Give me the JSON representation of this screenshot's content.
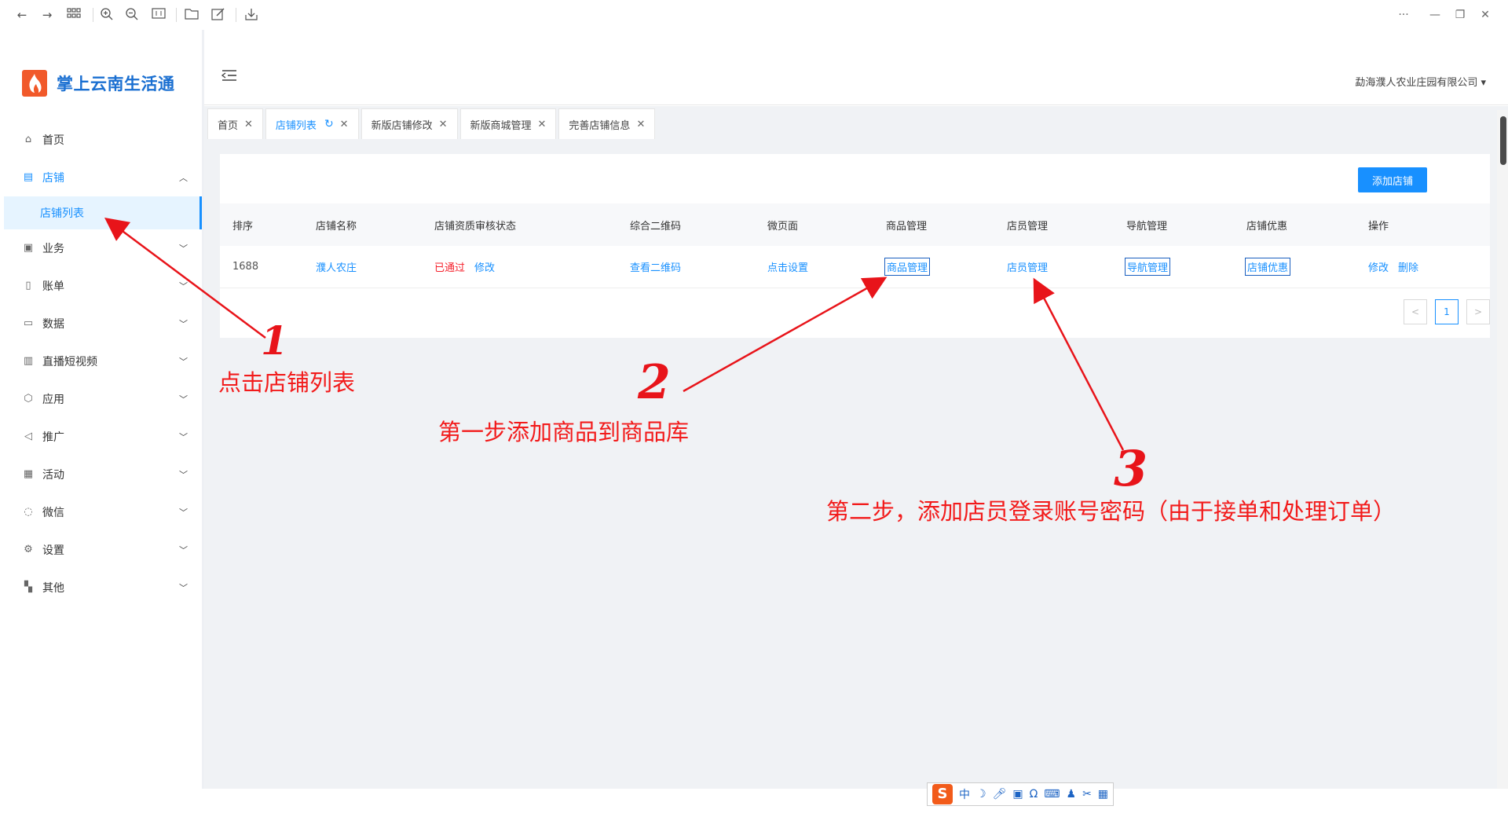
{
  "browser": {
    "more": "···",
    "minimize": "—",
    "restore": "❐",
    "close": "✕"
  },
  "app": {
    "title": "掌上云南生活通"
  },
  "header": {
    "company": "勐海濮人农业庄园有限公司"
  },
  "sidebar": {
    "items": [
      {
        "label": "首页",
        "icon": "home-icon"
      },
      {
        "label": "店铺",
        "icon": "shop-icon",
        "expanded": true
      },
      {
        "label": "业务",
        "icon": "business-icon"
      },
      {
        "label": "账单",
        "icon": "bill-icon"
      },
      {
        "label": "数据",
        "icon": "data-icon"
      },
      {
        "label": "直播短视频",
        "icon": "live-video-icon"
      },
      {
        "label": "应用",
        "icon": "app-icon"
      },
      {
        "label": "推广",
        "icon": "promote-icon"
      },
      {
        "label": "活动",
        "icon": "activity-icon"
      },
      {
        "label": "微信",
        "icon": "wechat-icon"
      },
      {
        "label": "设置",
        "icon": "settings-icon"
      },
      {
        "label": "其他",
        "icon": "other-icon"
      }
    ],
    "submenu_active": "店铺列表"
  },
  "tabs": [
    {
      "label": "首页"
    },
    {
      "label": "店铺列表",
      "active": true
    },
    {
      "label": "新版店铺修改"
    },
    {
      "label": "新版商城管理"
    },
    {
      "label": "完善店铺信息"
    }
  ],
  "toolbar": {
    "add_shop_label": "添加店铺"
  },
  "table": {
    "headers": [
      "排序",
      "店铺名称",
      "店铺资质审核状态",
      "综合二维码",
      "微页面",
      "商品管理",
      "店员管理",
      "导航管理",
      "店铺优惠",
      "操作"
    ],
    "rows": [
      {
        "sort": "1688",
        "name": "濮人农庄",
        "status": "已通过",
        "status_edit": "修改",
        "qrcode": "查看二维码",
        "micro_page": "点击设置",
        "goods": "商品管理",
        "staff": "店员管理",
        "nav": "导航管理",
        "discount": "店铺优惠",
        "op_edit": "修改",
        "op_delete": "删除"
      }
    ]
  },
  "pagination": {
    "prev": "<",
    "current": "1",
    "next": ">"
  },
  "annotations": {
    "num1": "1",
    "text1": "点击店铺列表",
    "num2": "2",
    "text2": "第一步添加商品到商品库",
    "num3": "3",
    "text3": "第二步，添加店员登录账号密码（由于接单和处理订单）"
  },
  "ime": {
    "logo": "S",
    "mode": "中"
  },
  "colors": {
    "primary": "#1890ff",
    "annotation": "#f21b1b",
    "logo_orange": "#f1592a",
    "status_passed": "#f5222d"
  }
}
